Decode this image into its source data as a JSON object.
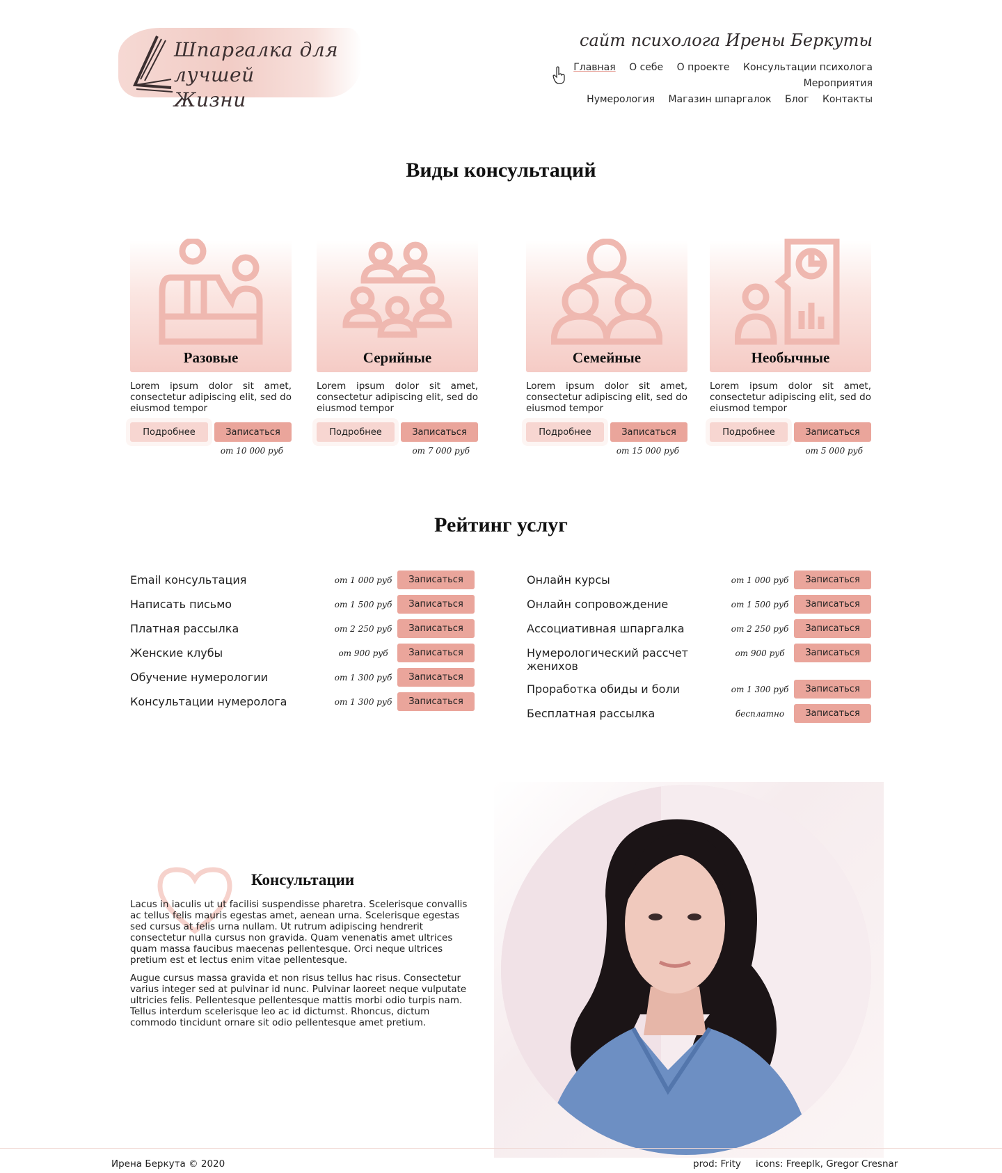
{
  "header": {
    "logo_line1": "Шпаргалка для лучшей",
    "logo_line2": "Жизни",
    "tagline": "сайт психолога Ирены Беркуты",
    "nav_row1": [
      "Главная",
      "О себе",
      "О проекте",
      "Консультации психолога",
      "Мероприятия"
    ],
    "nav_row2": [
      "Нумерология",
      "Магазин шпаргалок",
      "Блог",
      "Контакты"
    ],
    "active_nav": "Главная"
  },
  "types_section": {
    "title": "Виды консультаций",
    "more_label": "Подробнее",
    "book_label": "Записаться",
    "cards": [
      {
        "title": "Разовые",
        "icon": "therapy-session-icon",
        "desc": "Lorem ipsum dolor sit amet, consectetur adipiscing elit, sed do eiusmod tempor",
        "price": "от  10 000 руб"
      },
      {
        "title": "Серийные",
        "icon": "group-icon",
        "desc": "Lorem ipsum dolor sit amet, consectetur adipiscing elit, sed do eiusmod tempor",
        "price": "от  7 000 руб"
      },
      {
        "title": "Семейные",
        "icon": "family-icon",
        "desc": "Lorem ipsum dolor sit amet, consectetur adipiscing elit, sed do eiusmod tempor",
        "price": "от  15 000 руб"
      },
      {
        "title": "Необычные",
        "icon": "presentation-icon",
        "desc": "Lorem ipsum dolor sit amet, consectetur adipiscing elit, sed do eiusmod tempor",
        "price": "от  5 000 руб"
      }
    ]
  },
  "rating_section": {
    "title": "Рейтинг услуг",
    "book_label": "Записаться",
    "left": [
      {
        "name": "Email консультация",
        "price": "от  1 000 руб"
      },
      {
        "name": "Написать письмо",
        "price": "от  1 500 руб"
      },
      {
        "name": "Платная рассылка",
        "price": "от  2 250 руб"
      },
      {
        "name": "Женские клубы",
        "price": "от  900 руб"
      },
      {
        "name": "Обучение нумерологии",
        "price": "от  1 300 руб"
      },
      {
        "name": "Консультации нумеролога",
        "price": "от  1 300 руб"
      }
    ],
    "right": [
      {
        "name": "Онлайн курсы",
        "price": "от  1 000 руб"
      },
      {
        "name": "Онлайн сопровождение",
        "price": "от  1 500 руб"
      },
      {
        "name": "Ассоциативная шпаргалка",
        "price": "от  2 250 руб"
      },
      {
        "name": "Нумерологический рассчет женихов",
        "price": "от  900 руб"
      },
      {
        "name": "Проработка обиды и боли",
        "price": "от  1 300 руб"
      },
      {
        "name": "Бесплатная рассылка",
        "price": "бесплатно"
      }
    ]
  },
  "consult_section": {
    "title": "Консультации",
    "p1": "Lacus in iaculis ut ut facilisi suspendisse pharetra. Scelerisque convallis ac tellus felis mauris egestas amet, aenean urna. Scelerisque egestas sed cursus at felis urna nullam. Ut rutrum adipiscing hendrerit consectetur nulla cursus non gravida. Quam venenatis amet ultrices quam massa faucibus maecenas pellentesque. Orci neque ultrices pretium est et lectus enim vitae pellentesque.",
    "p2": "Augue cursus massa gravida et non risus tellus hac risus. Consectetur varius integer sed at pulvinar id nunc. Pulvinar laoreet neque vulputate ultricies felis. Pellentesque pellentesque mattis morbi odio turpis nam. Tellus interdum scelerisque leo ac id dictumst. Rhoncus, dictum commodo tincidunt ornare sit odio pellentesque amet pretium."
  },
  "footer": {
    "copyright": "Ирена Беркута © 2020",
    "prod": "prod: Frity",
    "icons": "icons: Freeplk, Gregor Cresnar"
  },
  "colors": {
    "accent": "#eaa59b",
    "accent_light": "#f7d6d1",
    "icon": "#efb8b0"
  }
}
